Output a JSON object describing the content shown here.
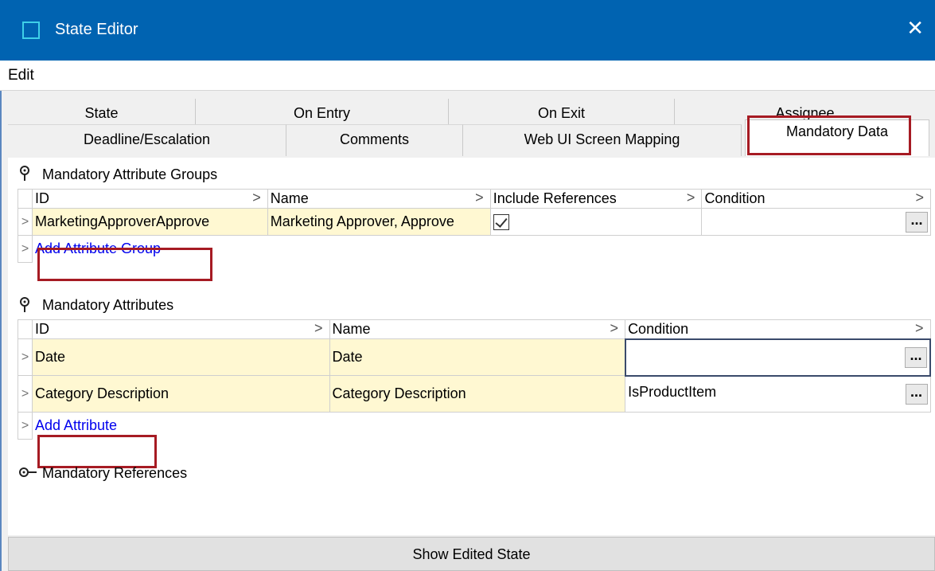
{
  "window": {
    "title": "State Editor",
    "close_glyph": "✕",
    "icon": "window-icon",
    "title_bar_color": "#0063b1"
  },
  "menu": {
    "edit_label": "Edit"
  },
  "tabs": {
    "row1": [
      "State",
      "On Entry",
      "On Exit",
      "Assignee"
    ],
    "row2": [
      "Deadline/Escalation",
      "Comments",
      "Web UI Screen Mapping",
      "Mandatory Data"
    ],
    "active": "Mandatory Data"
  },
  "groups_section": {
    "title": "Mandatory Attribute Groups",
    "columns": [
      "ID",
      "Name",
      "Include References",
      "Condition"
    ],
    "rows": [
      {
        "id": "MarketingApproverApprove",
        "name": "Marketing Approver, Approve",
        "include_references": true,
        "condition": ""
      }
    ],
    "add_label": "Add Attribute Group"
  },
  "attributes_section": {
    "title": "Mandatory Attributes",
    "columns": [
      "ID",
      "Name",
      "Condition"
    ],
    "rows": [
      {
        "id": "Date",
        "name": "Date",
        "condition": ""
      },
      {
        "id": "Category Description",
        "name": "Category Description",
        "condition": "IsProductItem"
      }
    ],
    "add_label": "Add Attribute"
  },
  "references_section": {
    "title": "Mandatory References"
  },
  "footer": {
    "button_label": "Show Edited State"
  },
  "glyphs": {
    "row_marker": ">",
    "ellipsis": "...",
    "header_arrow": ">"
  },
  "colors": {
    "highlight": "#a61b23",
    "readonly_cell": "#fff8d2",
    "link": "#0000ee"
  }
}
